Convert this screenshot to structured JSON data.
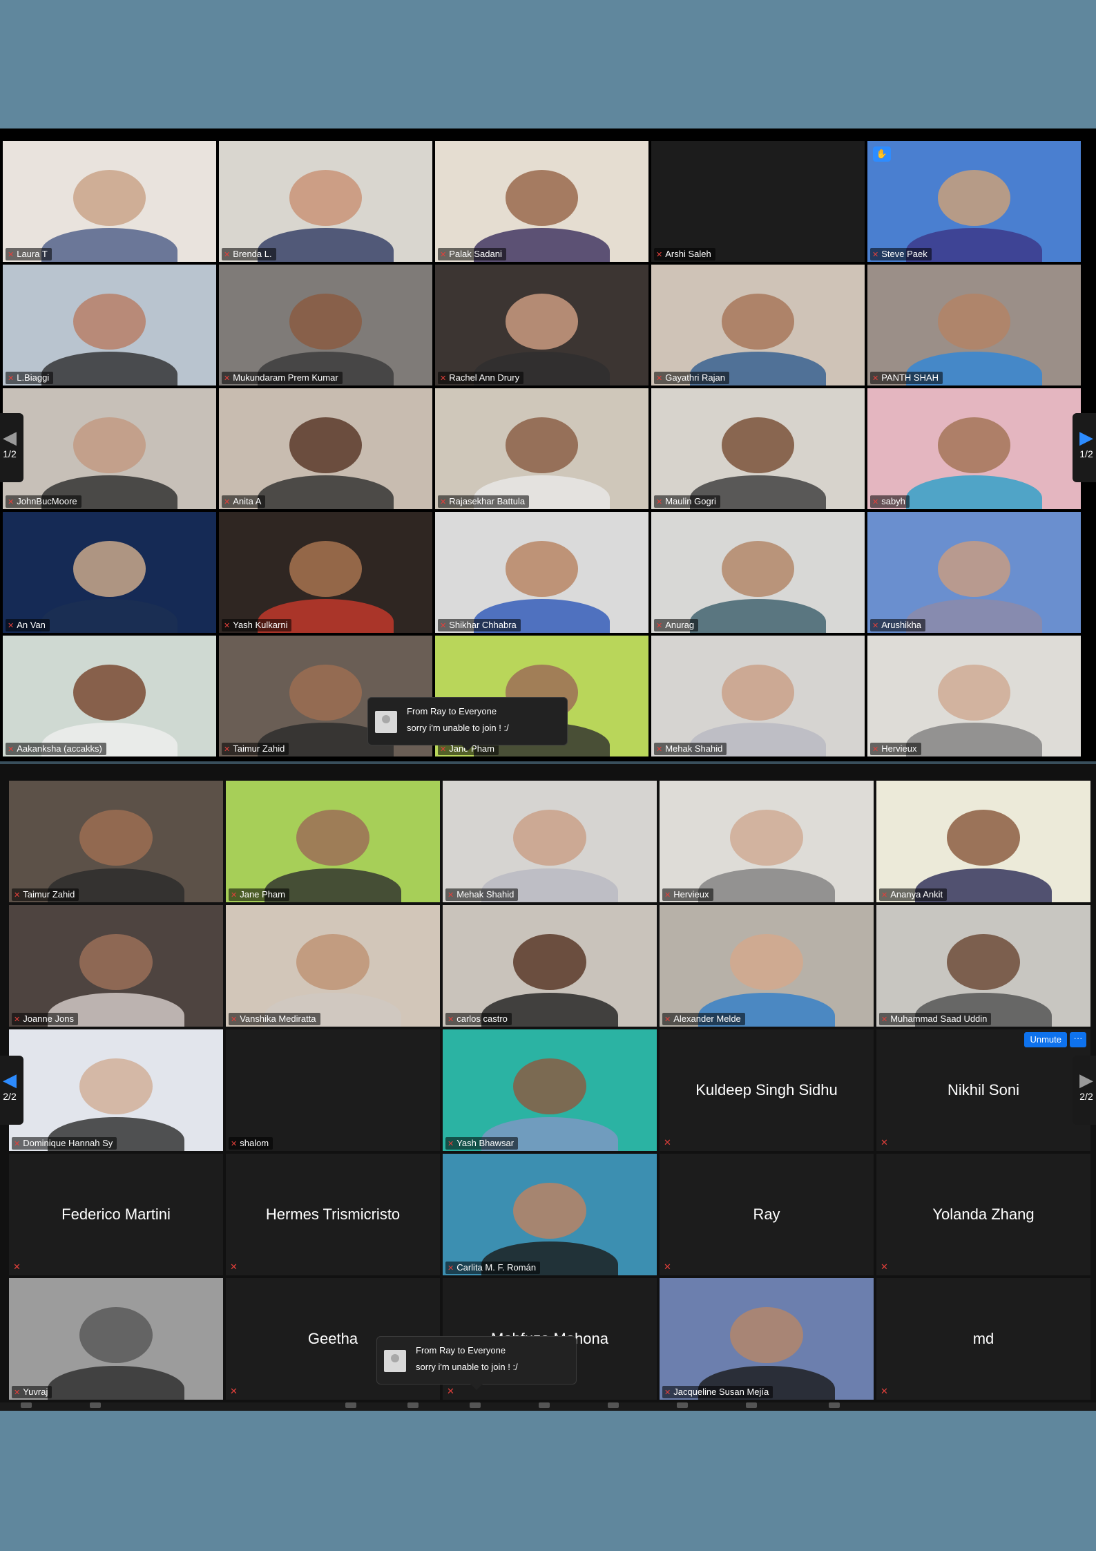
{
  "gallery_top": {
    "page_indicator": "1/2",
    "tiles": [
      {
        "name": "Laura T",
        "c1": "#e9e3dd",
        "c2": "#caa58a",
        "c3": "#4b5b87",
        "video": true
      },
      {
        "name": "Brenda L.",
        "c1": "#d9d6cf",
        "c2": "#c99478",
        "c3": "#2e3a62",
        "video": true
      },
      {
        "name": "Palak Sadani",
        "c1": "#e5ddd1",
        "c2": "#9a6a4d",
        "c3": "#3a2e5c",
        "video": true,
        "active": true
      },
      {
        "name": "Arshi Saleh",
        "video": false
      },
      {
        "name": "Steve Paek",
        "c1": "#4a7fd0",
        "c2": "#c9a07a",
        "c3": "#3b3686",
        "video": true,
        "hand": true
      },
      {
        "name": "L.Biaggi",
        "c1": "#b9c4cf",
        "c2": "#b78068",
        "c3": "#2d2d2d",
        "video": true
      },
      {
        "name": "Mukundaram Prem Kumar",
        "c1": "#7f7b78",
        "c2": "#8a5c42",
        "c3": "#3a3a3a",
        "video": true
      },
      {
        "name": "Rachel Ann Drury",
        "c1": "#3c3532",
        "c2": "#c99a80",
        "c3": "#2e2e2e",
        "video": true
      },
      {
        "name": "Gayathri Rajan",
        "c1": "#cfc3b7",
        "c2": "#a8785c",
        "c3": "#2f5d8f",
        "video": true
      },
      {
        "name": "PANTH SHAH",
        "c1": "#9b8f88",
        "c2": "#b38466",
        "c3": "#2f86d8",
        "video": true
      },
      {
        "name": "JohnBucMoore",
        "c1": "#c7c0b8",
        "c2": "#c29a83",
        "c3": "#2b2b2b",
        "video": true
      },
      {
        "name": "Anita A",
        "c1": "#c8bcb0",
        "c2": "#5a3a2a",
        "c3": "#2d2d2d",
        "video": true
      },
      {
        "name": "Rajasekhar Battula",
        "c1": "#cfc7ba",
        "c2": "#8c6048",
        "c3": "#e8e8e8",
        "video": true
      },
      {
        "name": "Maulin Gogri",
        "c1": "#d7d3cc",
        "c2": "#7b5239",
        "c3": "#3a3a3a",
        "video": true
      },
      {
        "name": "sabyh",
        "c1": "#e4b6c0",
        "c2": "#a47558",
        "c3": "#2aa0c8",
        "video": true
      },
      {
        "name": "An Van",
        "c1": "#152a55",
        "c2": "#c9a88b",
        "c3": "#1b2f53",
        "video": true
      },
      {
        "name": "Yash Kulkarni",
        "c1": "#2f2622",
        "c2": "#a6734f",
        "c3": "#c93a2c",
        "video": true
      },
      {
        "name": "Shikhar Chhabra",
        "c1": "#dadada",
        "c2": "#b88665",
        "c3": "#2c56b8",
        "video": true
      },
      {
        "name": "Anurag",
        "c1": "#d8d8d6",
        "c2": "#b4886a",
        "c3": "#3b5e6a",
        "video": true
      },
      {
        "name": "Arushikha",
        "c1": "#6a8fcf",
        "c2": "#c59c84",
        "c3": "#8e8aa6",
        "video": true
      },
      {
        "name": "Aakanksha (accakks)",
        "c1": "#cfd9d2",
        "c2": "#7a4a34",
        "c3": "#efefef",
        "video": true
      },
      {
        "name": "Taimur Zahid",
        "c1": "#6a5e55",
        "c2": "#9b6d52",
        "c3": "#2a2a2a",
        "video": true
      },
      {
        "name": "Jane Pham",
        "c1": "#b9d65a",
        "c2": "#9c6f57",
        "c3": "#2d2d2d",
        "video": true
      },
      {
        "name": "Mehak Shahid",
        "c1": "#d6d4d1",
        "c2": "#caa18a",
        "c3": "#b8b8c2",
        "video": true
      },
      {
        "name": "Hervieux",
        "c1": "#dedcd7",
        "c2": "#d0ac95",
        "c3": "#808080",
        "video": true
      }
    ],
    "chat_toast": {
      "title": "From Ray to Everyone",
      "message": "sorry i'm unable to join ! :/"
    }
  },
  "gallery_bottom": {
    "page_indicator": "2/2",
    "tiles": [
      {
        "name": "Taimur Zahid",
        "c1": "#5c5148",
        "c2": "#9b6d52",
        "c3": "#2a2a2a",
        "video": true
      },
      {
        "name": "Jane Pham",
        "c1": "#a7cf58",
        "c2": "#9c6f57",
        "c3": "#2d2d2d",
        "video": true
      },
      {
        "name": "Mehak Shahid",
        "c1": "#d6d4d1",
        "c2": "#caa18a",
        "c3": "#b8b8c2",
        "video": true
      },
      {
        "name": "Hervieux",
        "c1": "#dedcd7",
        "c2": "#d0ac95",
        "c3": "#808080",
        "video": true
      },
      {
        "name": "Ananya Ankit",
        "c1": "#ecead9",
        "c2": "#8d5e42",
        "c3": "#2b2b55",
        "video": true
      },
      {
        "name": "Joanne Jons",
        "c1": "#4e4440",
        "c2": "#9a6f58",
        "c3": "#d8d0cc",
        "video": true
      },
      {
        "name": "Vanshika Mediratta",
        "c1": "#d2c6b9",
        "c2": "#c09476",
        "c3": "#cfc8c2",
        "video": true
      },
      {
        "name": "carlos castro",
        "c1": "#c9c3bb",
        "c2": "#5a3a29",
        "c3": "#1f1f1f",
        "video": true
      },
      {
        "name": "Alexander Melde",
        "c1": "#b7b1a8",
        "c2": "#d4a98d",
        "c3": "#2f7ec8",
        "video": true
      },
      {
        "name": "Muhammad Saad Uddin",
        "c1": "#c8c6c1",
        "c2": "#6e4c39",
        "c3": "#4f4f4f",
        "video": true
      },
      {
        "name": "Dominique Hannah Sy",
        "c1": "#e2e5ec",
        "c2": "#d1b09a",
        "c3": "#2a2a2a",
        "video": true
      },
      {
        "name": "shalom",
        "video": false,
        "named_box": false
      },
      {
        "name": "Yash Bhawsar",
        "c1": "#2bb3a3",
        "c2": "#8a5d44",
        "c3": "#8296c4",
        "video": true
      },
      {
        "name": "Kuldeep Singh Sidhu",
        "video": false,
        "named_box": true
      },
      {
        "name": "Nikhil Soni",
        "video": false,
        "named_box": true,
        "unmute": true
      },
      {
        "name": "Federico Martini",
        "video": false,
        "named_box": true
      },
      {
        "name": "Hermes Trismicristo",
        "video": false,
        "named_box": true
      },
      {
        "name": "Carlita M. F. Román",
        "c1": "#3c8fb1",
        "c2": "#b88465",
        "c3": "#1a1a1a",
        "video": true
      },
      {
        "name": "Ray",
        "video": false,
        "named_box": true
      },
      {
        "name": "Yolanda Zhang",
        "video": false,
        "named_box": true
      },
      {
        "name": "Yuvraj",
        "c1": "#9c9c9c",
        "c2": "#5a5a5a",
        "c3": "#2a2a2a",
        "video": true
      },
      {
        "name": "Geetha",
        "video": false,
        "named_box": true
      },
      {
        "name": "Mahfuza Mohona",
        "video": false,
        "named_box": true
      },
      {
        "name": "Jacqueline Susan Mejía",
        "c1": "#6c7fae",
        "c2": "#b3866b",
        "c3": "#1a1a1a",
        "video": true
      },
      {
        "name": "md",
        "video": false,
        "named_box": true
      }
    ],
    "unmute_label": "Unmute",
    "more_label": "···",
    "chat_toast": {
      "title": "From Ray to Everyone",
      "message": "sorry i'm unable to join ! :/"
    }
  },
  "icons": {
    "mic_muted": "mic-muted-icon",
    "hand": "raised-hand-icon",
    "prev": "chevron-left-icon",
    "next": "chevron-right-icon"
  },
  "colors": {
    "background": "#60879d",
    "active_speaker": "#c9df6a",
    "accent": "#2d8cff",
    "muted": "#e2403b"
  }
}
